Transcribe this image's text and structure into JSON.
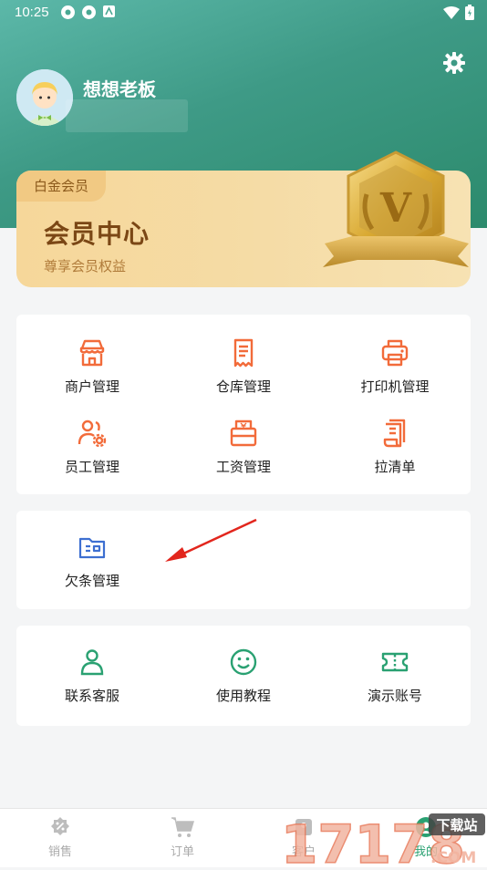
{
  "status": {
    "time": "10:25"
  },
  "profile": {
    "name": "想想老板"
  },
  "vip": {
    "tag": "白金会员",
    "title": "会员中心",
    "subtitle": "尊享会员权益",
    "badge_letter": "V"
  },
  "menu1": [
    {
      "label": "商户管理",
      "icon": "shop-icon"
    },
    {
      "label": "仓库管理",
      "icon": "receipt-icon"
    },
    {
      "label": "打印机管理",
      "icon": "printer-icon"
    },
    {
      "label": "员工管理",
      "icon": "staff-icon"
    },
    {
      "label": "工资管理",
      "icon": "salary-icon"
    },
    {
      "label": "拉清单",
      "icon": "list-icon"
    }
  ],
  "menu2": [
    {
      "label": "欠条管理",
      "icon": "folder-icon"
    }
  ],
  "menu3": [
    {
      "label": "联系客服",
      "icon": "person-icon"
    },
    {
      "label": "使用教程",
      "icon": "smile-icon"
    },
    {
      "label": "演示账号",
      "icon": "ticket-icon"
    }
  ],
  "tabs": [
    {
      "label": "销售"
    },
    {
      "label": "订单"
    },
    {
      "label": "客户"
    },
    {
      "label": "我的"
    }
  ],
  "watermark": {
    "number": "17178",
    "site": "下载站",
    "domain": ".COM"
  },
  "colors": {
    "orange": "#f26b3a",
    "blue": "#3d6fd1",
    "green": "#2aa172",
    "header": "#3e9a86"
  }
}
